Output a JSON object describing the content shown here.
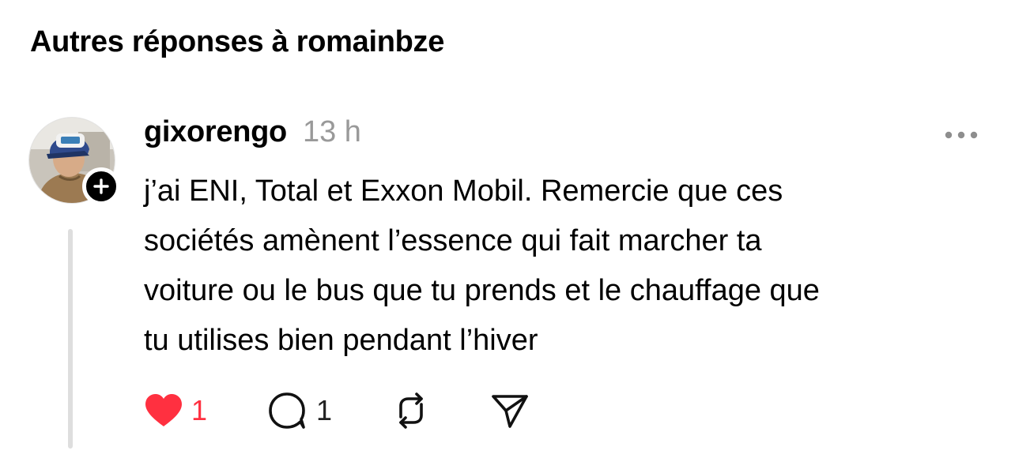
{
  "section": {
    "title": "Autres réponses à romainbze"
  },
  "post": {
    "username": "gixorengo",
    "timestamp": "13 h",
    "text_lines": [
      "j’ai ENI, Total et Exxon Mobil. Remercie que ces",
      "sociétés amènent l’essence qui fait marcher ta",
      "voiture ou le bus que tu prends et le chauffage que",
      "tu utilises bien pendant l’hiver"
    ],
    "likes": "1",
    "replies": "1",
    "liked": true
  },
  "colors": {
    "like_active": "#ff3040",
    "timestamp_gray": "#999999",
    "thread_line": "#dedede",
    "icon_stroke": "#111111"
  },
  "icons": {
    "avatar": "profile-photo",
    "follow": "plus-icon",
    "more": "ellipsis-icon",
    "like": "heart-icon",
    "reply": "speech-bubble-icon",
    "repost": "repost-icon",
    "share": "paper-plane-icon"
  }
}
